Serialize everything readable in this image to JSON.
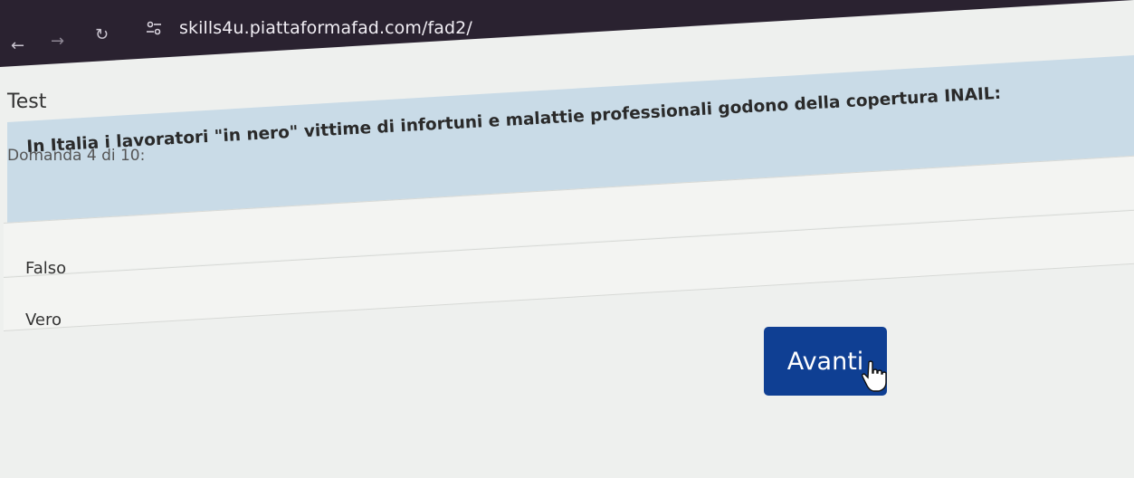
{
  "browser": {
    "url": "skills4u.piattaformafad.com/fad2/",
    "back_icon": "arrow-left-icon",
    "forward_icon": "arrow-right-icon",
    "reload_icon": "reload-icon",
    "site_info_icon": "tune-icon"
  },
  "page": {
    "title": "Test",
    "question_counter": "Domanda 4 di 10:",
    "question_text": "In Italia i lavoratori \"in nero\" vittime di infortuni e malattie professionali godono della copertura INAIL:",
    "options": [
      {
        "label": "Falso"
      },
      {
        "label": "Vero"
      }
    ],
    "next_button_label": "Avanti"
  },
  "colors": {
    "chrome_bg": "#2a2230",
    "question_bg": "#c9dbe7",
    "button_bg": "#0f3f93"
  }
}
